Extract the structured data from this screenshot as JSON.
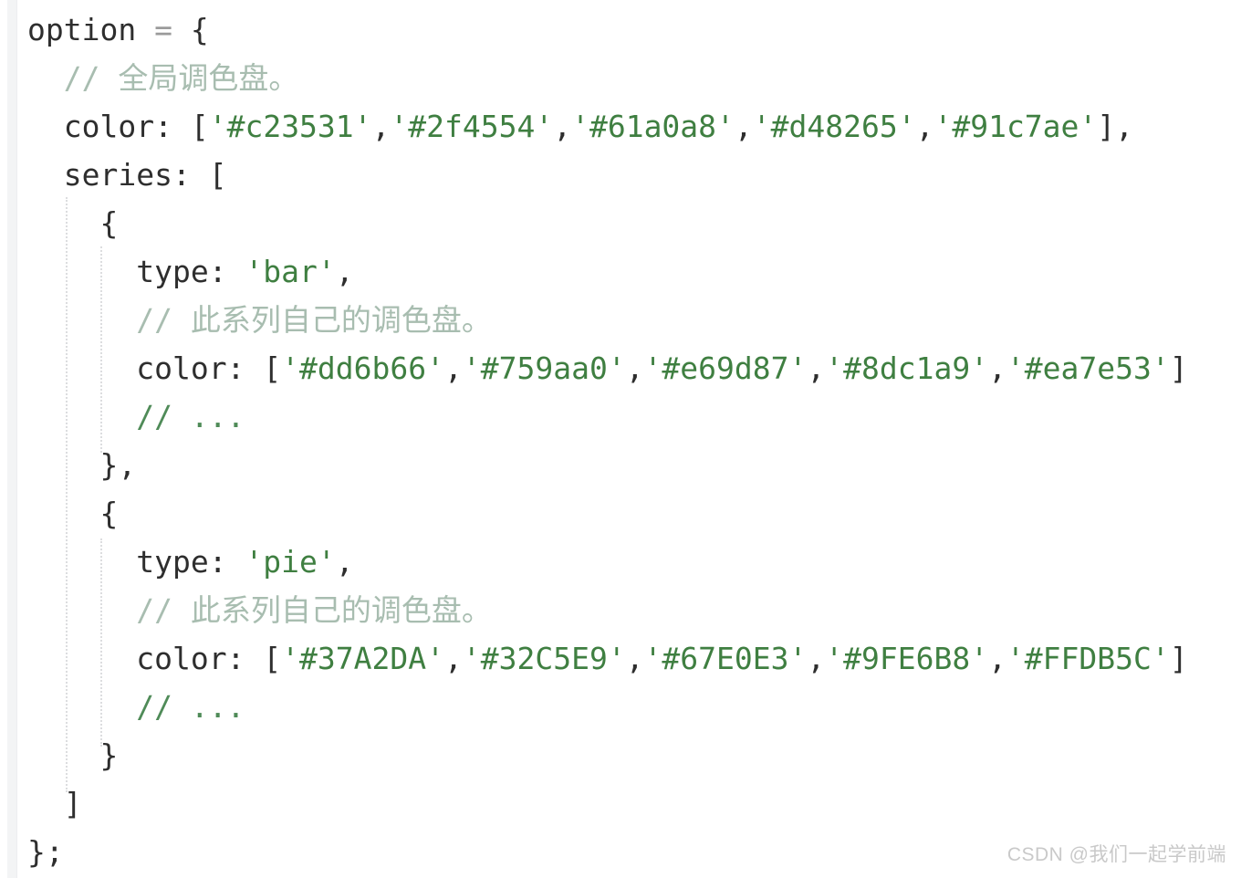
{
  "window": {
    "title": "ECharts color option code snippet",
    "background_color": "#ffffff",
    "gutter_color": "#f3f4f5"
  },
  "syntax_colors": {
    "plain": "#2e2e2e",
    "punctuation": "#2e2e2e",
    "operator": "#9b9b9b",
    "string": "#3f7f41",
    "comment_chinese": "#a8bdb0",
    "comment": "#4f8b58",
    "indent_guide": "#dcdddf"
  },
  "code": {
    "language": "javascript",
    "line_count": 17,
    "lines": [
      {
        "n": 1,
        "indent": 0,
        "tokens": [
          {
            "t": "option",
            "c": "plain"
          },
          {
            "t": " ",
            "c": "plain"
          },
          {
            "t": "=",
            "c": "op"
          },
          {
            "t": " ",
            "c": "plain"
          },
          {
            "t": "{",
            "c": "punct"
          }
        ]
      },
      {
        "n": 2,
        "indent": 1,
        "tokens": [
          {
            "t": "// 全局调色盘。",
            "c": "cmt-cn"
          }
        ]
      },
      {
        "n": 3,
        "indent": 1,
        "tokens": [
          {
            "t": "color:",
            "c": "plain"
          },
          {
            "t": " ",
            "c": "plain"
          },
          {
            "t": "[",
            "c": "punct"
          },
          {
            "t": "'#c23531'",
            "c": "str"
          },
          {
            "t": ",",
            "c": "punct"
          },
          {
            "t": "'#2f4554'",
            "c": "str"
          },
          {
            "t": ",",
            "c": "punct"
          },
          {
            "t": "'#61a0a8'",
            "c": "str"
          },
          {
            "t": ",",
            "c": "punct"
          },
          {
            "t": "'#d48265'",
            "c": "str"
          },
          {
            "t": ",",
            "c": "punct"
          },
          {
            "t": "'#91c7ae'",
            "c": "str"
          },
          {
            "t": "],",
            "c": "punct"
          }
        ]
      },
      {
        "n": 4,
        "indent": 1,
        "tokens": [
          {
            "t": "series:",
            "c": "plain"
          },
          {
            "t": " ",
            "c": "plain"
          },
          {
            "t": "[",
            "c": "punct"
          }
        ]
      },
      {
        "n": 5,
        "indent": 2,
        "tokens": [
          {
            "t": "{",
            "c": "punct"
          }
        ]
      },
      {
        "n": 6,
        "indent": 3,
        "tokens": [
          {
            "t": "type:",
            "c": "plain"
          },
          {
            "t": " ",
            "c": "plain"
          },
          {
            "t": "'bar'",
            "c": "str"
          },
          {
            "t": ",",
            "c": "punct"
          }
        ]
      },
      {
        "n": 7,
        "indent": 3,
        "tokens": [
          {
            "t": "// 此系列自己的调色盘。",
            "c": "cmt-cn"
          }
        ]
      },
      {
        "n": 8,
        "indent": 3,
        "tokens": [
          {
            "t": "color:",
            "c": "plain"
          },
          {
            "t": " ",
            "c": "plain"
          },
          {
            "t": "[",
            "c": "punct"
          },
          {
            "t": "'#dd6b66'",
            "c": "str"
          },
          {
            "t": ",",
            "c": "punct"
          },
          {
            "t": "'#759aa0'",
            "c": "str"
          },
          {
            "t": ",",
            "c": "punct"
          },
          {
            "t": "'#e69d87'",
            "c": "str"
          },
          {
            "t": ",",
            "c": "punct"
          },
          {
            "t": "'#8dc1a9'",
            "c": "str"
          },
          {
            "t": ",",
            "c": "punct"
          },
          {
            "t": "'#ea7e53'",
            "c": "str"
          },
          {
            "t": "]",
            "c": "punct"
          }
        ]
      },
      {
        "n": 9,
        "indent": 3,
        "tokens": [
          {
            "t": "// ...",
            "c": "cmt"
          }
        ]
      },
      {
        "n": 10,
        "indent": 2,
        "tokens": [
          {
            "t": "},",
            "c": "punct"
          }
        ]
      },
      {
        "n": 11,
        "indent": 2,
        "tokens": [
          {
            "t": "{",
            "c": "punct"
          }
        ]
      },
      {
        "n": 12,
        "indent": 3,
        "tokens": [
          {
            "t": "type:",
            "c": "plain"
          },
          {
            "t": " ",
            "c": "plain"
          },
          {
            "t": "'pie'",
            "c": "str"
          },
          {
            "t": ",",
            "c": "punct"
          }
        ]
      },
      {
        "n": 13,
        "indent": 3,
        "tokens": [
          {
            "t": "// 此系列自己的调色盘。",
            "c": "cmt-cn"
          }
        ]
      },
      {
        "n": 14,
        "indent": 3,
        "tokens": [
          {
            "t": "color:",
            "c": "plain"
          },
          {
            "t": " ",
            "c": "plain"
          },
          {
            "t": "[",
            "c": "punct"
          },
          {
            "t": "'#37A2DA'",
            "c": "str"
          },
          {
            "t": ",",
            "c": "punct"
          },
          {
            "t": "'#32C5E9'",
            "c": "str"
          },
          {
            "t": ",",
            "c": "punct"
          },
          {
            "t": "'#67E0E3'",
            "c": "str"
          },
          {
            "t": ",",
            "c": "punct"
          },
          {
            "t": "'#9FE6B8'",
            "c": "str"
          },
          {
            "t": ",",
            "c": "punct"
          },
          {
            "t": "'#FFDB5C'",
            "c": "str"
          },
          {
            "t": "]",
            "c": "punct"
          }
        ]
      },
      {
        "n": 15,
        "indent": 3,
        "tokens": [
          {
            "t": "// ...",
            "c": "cmt"
          }
        ]
      },
      {
        "n": 16,
        "indent": 2,
        "tokens": [
          {
            "t": "}",
            "c": "punct"
          }
        ]
      },
      {
        "n": 17,
        "indent": 1,
        "tokens": [
          {
            "t": "]",
            "c": "punct"
          }
        ]
      },
      {
        "n": 18,
        "indent": 0,
        "tokens": [
          {
            "t": "};",
            "c": "punct"
          }
        ]
      }
    ],
    "global_palette": [
      "#c23531",
      "#2f4554",
      "#61a0a8",
      "#d48265",
      "#91c7ae"
    ],
    "bar_series_palette": [
      "#dd6b66",
      "#759aa0",
      "#e69d87",
      "#8dc1a9",
      "#ea7e53"
    ],
    "pie_series_palette": [
      "#37A2DA",
      "#32C5E9",
      "#67E0E3",
      "#9FE6B8",
      "#FFDB5C"
    ]
  },
  "watermark": {
    "text": "CSDN @我们一起学前端"
  }
}
